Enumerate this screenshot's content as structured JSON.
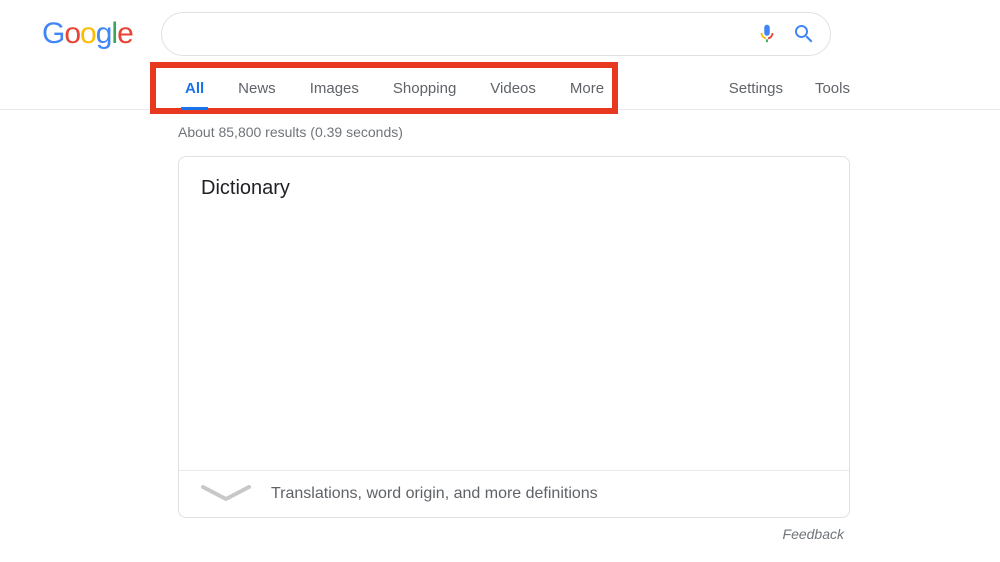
{
  "logo": {
    "text": "Google"
  },
  "search": {
    "value": ""
  },
  "tabs": {
    "items": [
      {
        "label": "All",
        "active": true
      },
      {
        "label": "News",
        "active": false
      },
      {
        "label": "Images",
        "active": false
      },
      {
        "label": "Shopping",
        "active": false
      },
      {
        "label": "Videos",
        "active": false
      },
      {
        "label": "More",
        "active": false
      }
    ]
  },
  "tools": {
    "settings_label": "Settings",
    "tools_label": "Tools"
  },
  "results": {
    "stats": "About 85,800 results (0.39 seconds)"
  },
  "card": {
    "title": "Dictionary",
    "expand_text": "Translations, word origin, and more definitions"
  },
  "feedback_label": "Feedback",
  "highlight": {
    "color": "#e8381f"
  }
}
